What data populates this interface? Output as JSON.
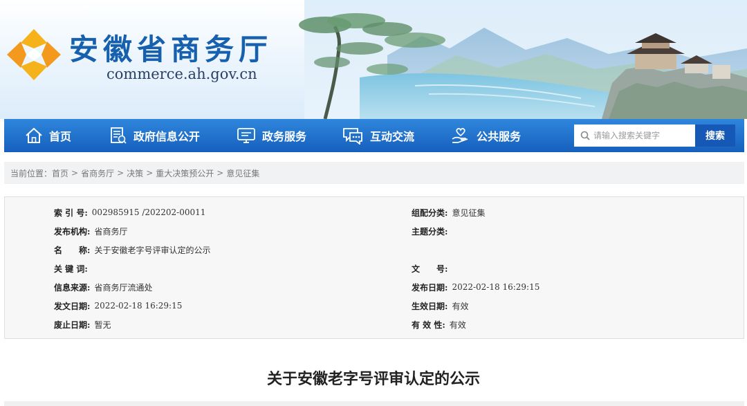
{
  "header": {
    "site_title": "安徽省商务厅",
    "site_url": "commerce.ah.gov.cn",
    "brand_blue": "#1660ad",
    "logo_colors": [
      "#f6b21a",
      "#f08a1c"
    ]
  },
  "nav": {
    "items": [
      {
        "label": "首页",
        "icon": "home-icon"
      },
      {
        "label": "政府信息公开",
        "icon": "document-list-icon"
      },
      {
        "label": "政务服务",
        "icon": "monitor-icon"
      },
      {
        "label": "互动交流",
        "icon": "chat-bubble-icon"
      },
      {
        "label": "公共服务",
        "icon": "hand-heart-icon"
      }
    ],
    "search_placeholder": "请输入搜索关键字",
    "search_button": "搜索",
    "nav_color": "#1e6fcc"
  },
  "breadcrumb": {
    "prefix": "当前位置：",
    "items": [
      "首页",
      "省商务厅",
      "决策",
      "重大决策预公开",
      "意见征集"
    ],
    "separator": ">"
  },
  "info": {
    "index_label": "索 引 号:",
    "index_value": "002985915 /202202-00011",
    "category_label": "组配分类:",
    "category_value": "意见征集",
    "publisher_label": "发布机构:",
    "publisher_value": "省商务厅",
    "topic_label": "主题分类:",
    "topic_value": "",
    "name_label_1": "名",
    "name_label_2": "称:",
    "name_value": "关于安徽老字号评审认定的公示",
    "keywords_label": "关 键 词:",
    "keywords_value": "",
    "doc_no_label_1": "文",
    "doc_no_label_2": "号:",
    "doc_no_value": "",
    "source_label": "信息来源:",
    "source_value": "省商务厅流通处",
    "pub_date_label": "发布日期:",
    "pub_date_value": "2022-02-18 16:29:15",
    "issue_date_label": "发文日期:",
    "issue_date_value": "2022-02-18 16:29:15",
    "effective_date_label": "生效日期:",
    "effective_date_value": "有效",
    "abolish_date_label": "废止日期:",
    "abolish_date_value": "暂无",
    "validity_label": "有 效 性:",
    "validity_value": "有效"
  },
  "article": {
    "title": "关于安徽老字号评审认定的公示"
  }
}
